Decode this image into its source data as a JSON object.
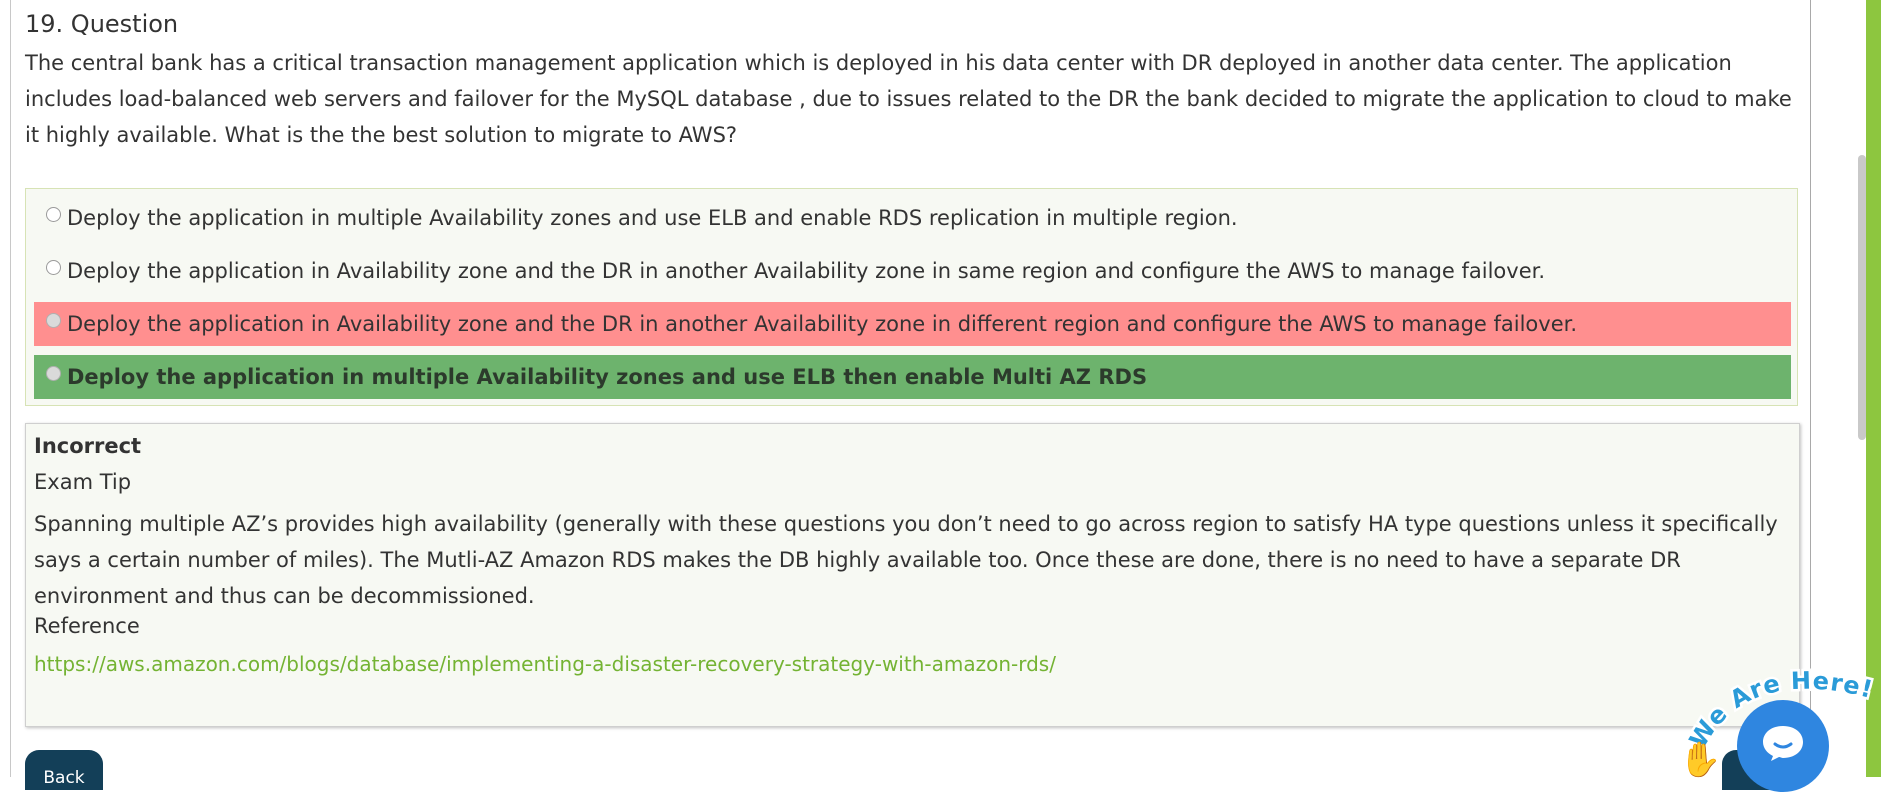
{
  "question": {
    "title": "19. Question",
    "text": "The central bank has a critical transaction management application which is deployed in his data center with DR deployed in another data center. The application includes load-balanced web servers and failover for the MySQL database , due to issues related to the DR the bank decided to migrate the application to cloud to make it highly available. What is the the best solution to migrate to AWS?"
  },
  "options": [
    {
      "label": "Deploy the application in multiple Availability zones and use ELB and enable RDS replication in multiple region.",
      "state": "neutral"
    },
    {
      "label": "Deploy the application in Availability zone and the DR in another Availability zone in same region and configure the AWS to manage failover.",
      "state": "neutral"
    },
    {
      "label": "Deploy the application in Availability zone and the DR in another Availability zone in different region and configure the AWS to manage failover.",
      "state": "incorrect"
    },
    {
      "label": "Deploy the application in multiple Availability zones and use ELB then enable Multi AZ RDS",
      "state": "correct"
    }
  ],
  "explanation": {
    "status": "Incorrect",
    "tip_heading": "Exam Tip",
    "body": "Spanning multiple AZ’s provides high availability (generally with these questions you don’t need to go across region to satisfy HA type questions unless it specifically says a certain number of miles). The Mutli-AZ Amazon RDS makes the DB highly available too. Once these are done, there is no need to have a separate DR environment and thus can be decommissioned.",
    "reference_heading": "Reference",
    "reference_link": "https://aws.amazon.com/blogs/database/implementing-a-disaster-recovery-strategy-with-amazon-rds/"
  },
  "nav": {
    "back_label": "Back"
  },
  "chat": {
    "banner_text": "We Are Here!",
    "icon": "chat-icon",
    "hand_icon": "waving-hand-icon"
  },
  "colors": {
    "incorrect": "#ff8f8f",
    "correct": "#6db36d",
    "link": "#74b333",
    "button": "#133f58",
    "chat": "#2f86e0",
    "accent_strip": "#8dc63f"
  }
}
